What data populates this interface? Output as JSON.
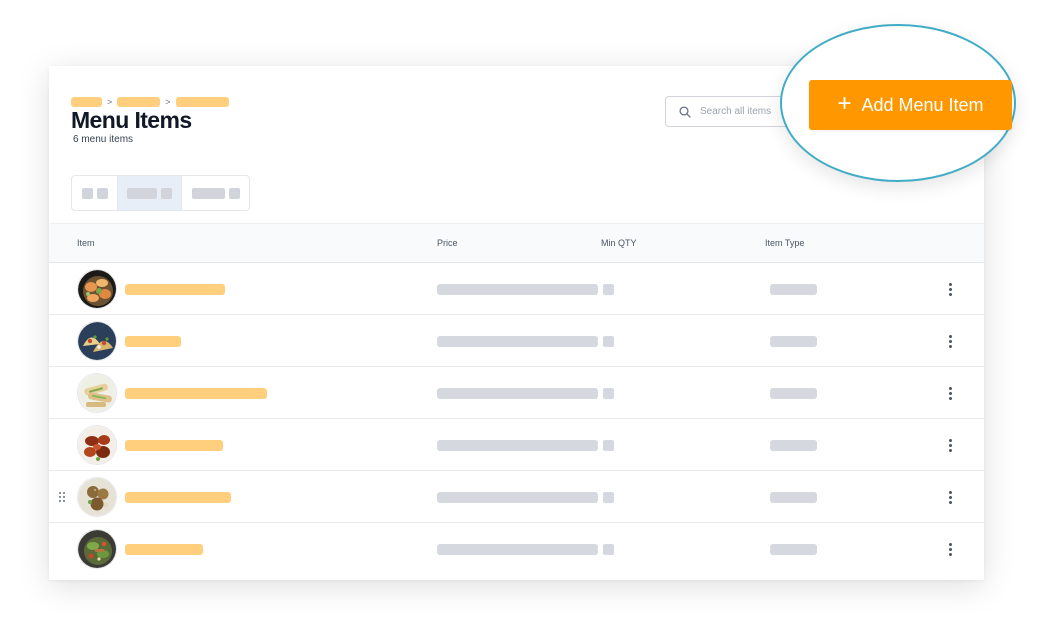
{
  "header": {
    "title": "Menu Items",
    "count": "6 menu items",
    "breadcrumb_separators": [
      ">",
      ">"
    ]
  },
  "search": {
    "placeholder": "Search all items",
    "value": ""
  },
  "add_button": {
    "label": "Add Menu Item",
    "icon": "plus-icon"
  },
  "table": {
    "columns": [
      "Item",
      "Price",
      "Min QTY",
      "Item Type"
    ],
    "rows": [
      {
        "image": "shrimp-dish"
      },
      {
        "image": "tacos-dish"
      },
      {
        "image": "wraps-dish"
      },
      {
        "image": "wings-dish"
      },
      {
        "image": "fritters-dish"
      },
      {
        "image": "salad-dish"
      }
    ]
  },
  "colors": {
    "accent": "#ff9800",
    "highlight_ring": "#41acc6",
    "placeholder_name": "#ffcf7d",
    "placeholder_gray": "#d5d8de",
    "active_segment": "#e8eef8"
  }
}
